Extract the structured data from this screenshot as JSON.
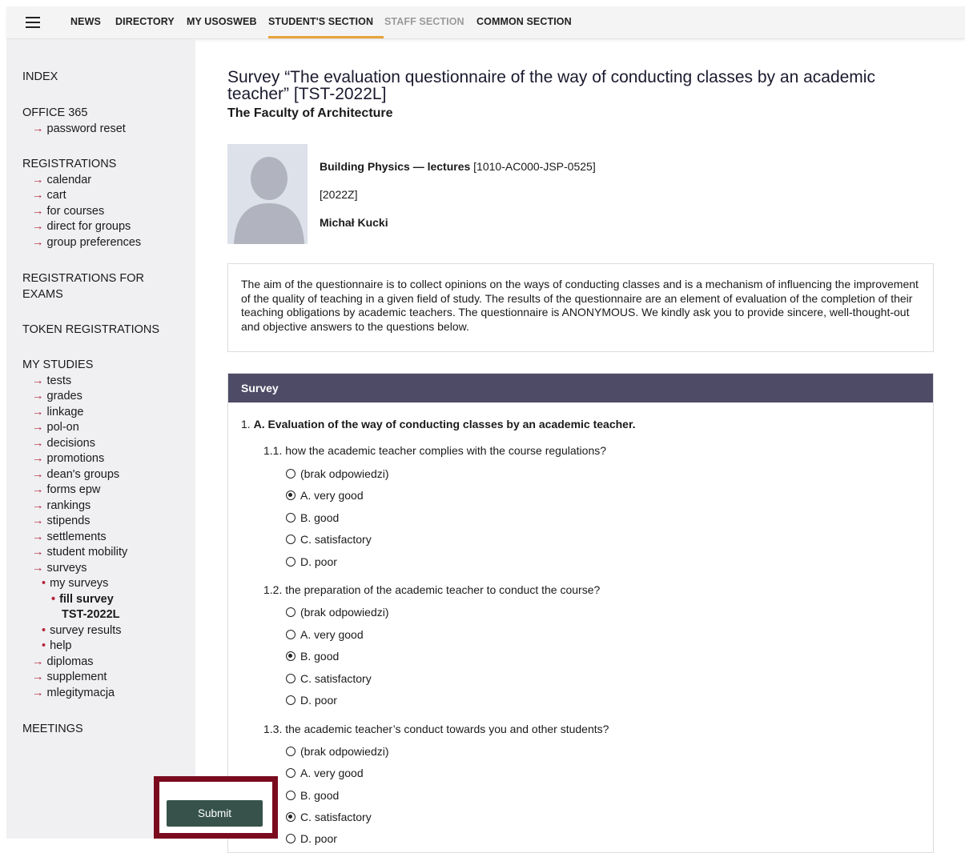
{
  "nav": {
    "items": [
      {
        "label": "NEWS"
      },
      {
        "label": "DIRECTORY"
      },
      {
        "label": "MY USOSWEB"
      },
      {
        "label": "STUDENT'S SECTION"
      },
      {
        "label": "STAFF SECTION"
      },
      {
        "label": "COMMON SECTION"
      }
    ],
    "active": "STUDENT'S SECTION",
    "accent_color": "#e8a33b"
  },
  "sidebar": {
    "index": "INDEX",
    "office": {
      "head": "OFFICE 365",
      "items": [
        "password reset"
      ]
    },
    "registrations": {
      "head": "REGISTRATIONS",
      "items": [
        "calendar",
        "cart",
        "for courses",
        "direct for groups",
        "group preferences"
      ]
    },
    "exams": {
      "head_line1": "REGISTRATIONS FOR",
      "head_line2": "EXAMS"
    },
    "token": "TOKEN REGISTRATIONS",
    "studies": {
      "head": "MY STUDIES",
      "items": [
        "tests",
        "grades",
        "linkage",
        "pol-on",
        "decisions",
        "promotions",
        "dean's groups",
        "forms epw",
        "rankings",
        "stipends",
        "settlements",
        "student mobility",
        "surveys"
      ],
      "surveys_sub": {
        "my_surveys": "my surveys",
        "fill_survey_line1": "fill survey",
        "fill_survey_line2": "TST-2022L",
        "survey_results": "survey results",
        "help": "help"
      },
      "after": [
        "diplomas",
        "supplement",
        "mlegitymacja"
      ]
    },
    "meetings": "MEETINGS"
  },
  "main": {
    "title_line1": "Survey “The evaluation questionnaire of the way of conducting classes by an academic",
    "title_line2": "teacher” [TST-2022L]",
    "faculty": "The Faculty of Architecture",
    "course": {
      "name": "Building Physics — lectures",
      "code": "[1010-AC000-JSP-0525]",
      "term": "[2022Z]",
      "teacher": "Michał Kucki"
    },
    "info": "The aim of the questionnaire is to collect opinions on the ways of conducting classes and is a mechanism of influencing the improvement of the quality of teaching in a given field of study. The results of the questionnaire are an element of evaluation of the completion of their teaching obligations by academic teachers. The questionnaire is ANONYMOUS. We kindly ask you to provide sincere, well-thought-out and objective answers to the questions below.",
    "survey": {
      "header": "Survey",
      "section_num": "1.",
      "section_title": "A. Evaluation of the way of conducting classes by an academic teacher.",
      "questions": [
        {
          "label": "1.1. how the academic teacher complies with the course regulations?",
          "options": [
            "(brak odpowiedzi)",
            "A. very good",
            "B. good",
            "C. satisfactory",
            "D. poor"
          ],
          "selected": 1
        },
        {
          "label": "1.2. the preparation of the academic teacher to conduct the course?",
          "options": [
            "(brak odpowiedzi)",
            "A. very good",
            "B. good",
            "C. satisfactory",
            "D. poor"
          ],
          "selected": 2
        },
        {
          "label": "1.3. the academic teacher’s conduct towards you and other students?",
          "options": [
            "(brak odpowiedzi)",
            "A. very good",
            "B. good",
            "C. satisfactory",
            "D. poor"
          ],
          "selected": 3
        }
      ]
    }
  },
  "submit": {
    "label": "Submit",
    "color": "#36524b",
    "highlight_color": "#7a0b1e"
  }
}
